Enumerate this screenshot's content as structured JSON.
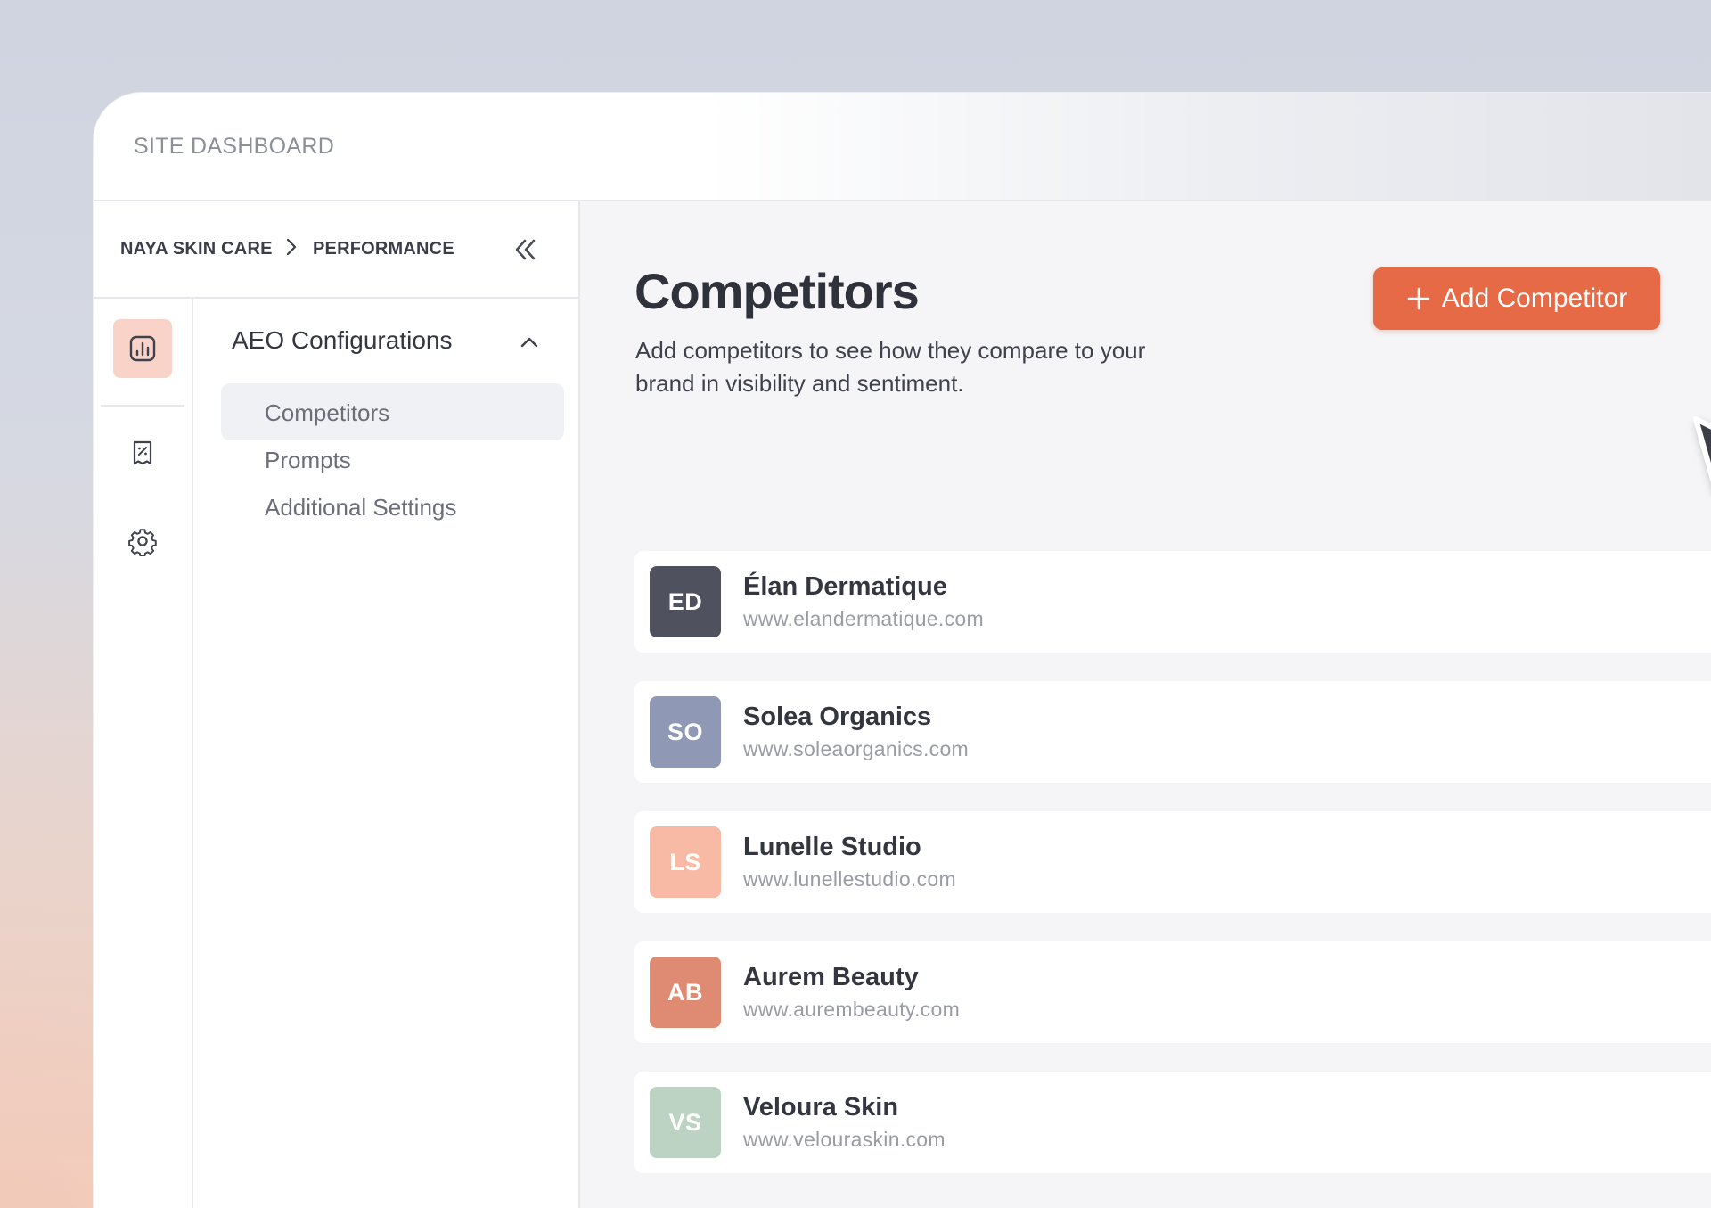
{
  "app": {
    "title": "SITE DASHBOARD"
  },
  "breadcrumb": [
    {
      "label": "NAYA SKIN CARE"
    },
    {
      "label": "PERFORMANCE"
    }
  ],
  "rail": {
    "items": [
      {
        "icon": "bar-chart-icon",
        "active": true
      },
      {
        "icon": "report-percent-icon",
        "active": false
      },
      {
        "icon": "gear-icon",
        "active": false
      }
    ]
  },
  "nav": {
    "group_label": "AEO Configurations",
    "items": [
      {
        "label": "Competitors",
        "active": true
      },
      {
        "label": "Prompts",
        "active": false
      },
      {
        "label": "Additional Settings",
        "active": false
      }
    ]
  },
  "main": {
    "title": "Competitors",
    "subtitle": "Add competitors to see how they compare to your brand in visibility and sentiment.",
    "add_button_label": "Add Competitor"
  },
  "competitors": [
    {
      "initials": "ED",
      "name": "Élan Dermatique",
      "url": "www.elandermatique.com",
      "color": "#4f525e"
    },
    {
      "initials": "SO",
      "name": "Solea Organics",
      "url": "www.soleaorganics.com",
      "color": "#8f98b4"
    },
    {
      "initials": "LS",
      "name": "Lunelle Studio",
      "url": "www.lunellestudio.com",
      "color": "#f8b9a5"
    },
    {
      "initials": "AB",
      "name": "Aurem Beauty",
      "url": "www.aurembeauty.com",
      "color": "#df8b74"
    },
    {
      "initials": "VS",
      "name": "Veloura Skin",
      "url": "www.velouraskin.com",
      "color": "#bcd3c4"
    }
  ],
  "colors": {
    "accent": "#e66a45",
    "active_rail": "#f9d3c7"
  }
}
